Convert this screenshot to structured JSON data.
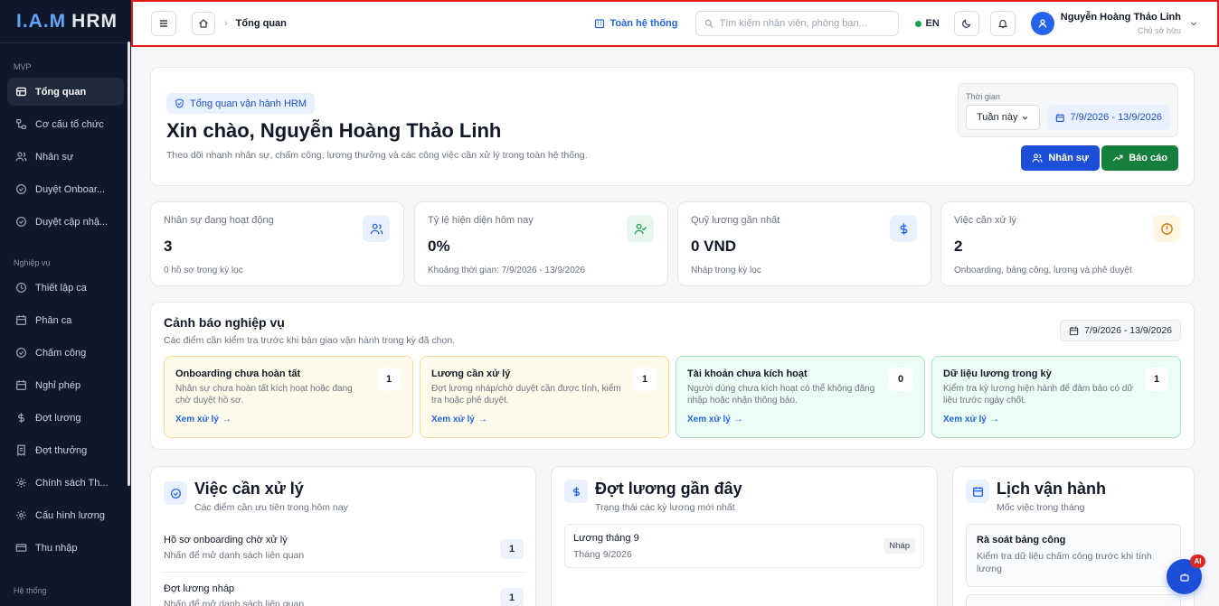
{
  "app": {
    "logo_iam": "I.A.M",
    "logo_hrm": "HRM"
  },
  "sidebar": {
    "sections": [
      "MVP",
      "Nghiệp vụ",
      "Hệ thống"
    ],
    "items": [
      {
        "label": "Tổng quan",
        "icon": "dashboard-icon"
      },
      {
        "label": "Cơ cấu tổ chức",
        "icon": "org-chart-icon"
      },
      {
        "label": "Nhân sự",
        "icon": "users-icon"
      },
      {
        "label": "Duyệt Onboar...",
        "icon": "check-circle-icon"
      },
      {
        "label": "Duyệt cập nhậ...",
        "icon": "check-circle-icon"
      },
      {
        "label": "Thiết lập ca",
        "icon": "clock-icon"
      },
      {
        "label": "Phân ca",
        "icon": "calendar-icon"
      },
      {
        "label": "Chấm công",
        "icon": "check-circle-icon"
      },
      {
        "label": "Nghỉ phép",
        "icon": "calendar-icon"
      },
      {
        "label": "Đợt lương",
        "icon": "dollar-icon"
      },
      {
        "label": "Đợt thưởng",
        "icon": "receipt-icon"
      },
      {
        "label": "Chính sách Th...",
        "icon": "gear-icon"
      },
      {
        "label": "Cấu hình lương",
        "icon": "gear-icon"
      },
      {
        "label": "Thu nhập",
        "icon": "wallet-icon"
      }
    ]
  },
  "header": {
    "breadcrumb": "Tổng quan",
    "scope": "Toàn hệ thống",
    "search_placeholder": "Tìm kiếm nhân viên, phòng ban...",
    "lang": "EN",
    "user_name": "Nguyễn Hoàng Thảo Linh",
    "user_role": "Chủ sở hữu"
  },
  "hero": {
    "badge": "Tổng quan vận hành HRM",
    "title": "Xin chào, Nguyễn Hoàng Thảo Linh",
    "subtitle": "Theo dõi nhanh nhân sự, chấm công, lương thưởng và các công việc cần xử lý trong toàn hệ thống.",
    "time_label": "Thời gian",
    "period": "Tuần này",
    "range": "7/9/2026 - 13/9/2026",
    "btn_staff": "Nhân sự",
    "btn_report": "Báo cáo"
  },
  "stats": [
    {
      "label": "Nhân sự đang hoạt động",
      "value": "3",
      "sub": "0 hồ sơ trong kỳ lọc",
      "icon": "users-icon",
      "color": "#2563eb",
      "bg": "#eaf1fe"
    },
    {
      "label": "Tỷ lệ hiện diện hôm nay",
      "value": "0%",
      "sub": "Khoảng thời gian: 7/9/2026 - 13/9/2026",
      "icon": "user-check-icon",
      "color": "#16a34a",
      "bg": "#e8f7ee"
    },
    {
      "label": "Quỹ lương gần nhất",
      "value": "0 VND",
      "sub": "Nháp trong kỳ lọc",
      "icon": "dollar-icon",
      "color": "#2563eb",
      "bg": "#eaf1fe"
    },
    {
      "label": "Việc cần xử lý",
      "value": "2",
      "sub": "Onboarding, bảng công, lương và phê duyệt",
      "icon": "alert-circle-icon",
      "color": "#d97706",
      "bg": "#fef6e4"
    }
  ],
  "alerts": {
    "title": "Cảnh báo nghiệp vụ",
    "subtitle": "Các điểm cần kiểm tra trước khi bàn giao vận hành trong kỳ đã chọn.",
    "range": "7/9/2026 - 13/9/2026",
    "link": "Xem xử lý",
    "items": [
      {
        "title": "Onboarding chưa hoàn tất",
        "desc": "Nhân sự chưa hoàn tất kích hoạt hoặc đang chờ duyệt hồ sơ.",
        "count": "1",
        "bg": "#fffbeb",
        "border": "#f6dd97"
      },
      {
        "title": "Lương cần xử lý",
        "desc": "Đợt lương nháp/chờ duyệt cần được tính, kiểm tra hoặc phê duyệt.",
        "count": "1",
        "bg": "#fffbeb",
        "border": "#f6dd97"
      },
      {
        "title": "Tài khoản chưa kích hoạt",
        "desc": "Người dùng chưa kích hoạt có thể không đăng nhập hoặc nhận thông báo.",
        "count": "0",
        "bg": "#ecfdf5",
        "border": "#a7e3c4"
      },
      {
        "title": "Dữ liệu lương trong kỳ",
        "desc": "Kiểm tra kỳ lương hiện hành để đảm bảo có dữ liệu trước ngày chốt.",
        "count": "1",
        "bg": "#ecfdf5",
        "border": "#a7e3c4"
      }
    ]
  },
  "tasks": {
    "title": "Việc cần xử lý",
    "subtitle": "Các điểm cần ưu tiên trong hôm nay",
    "items": [
      {
        "title": "Hồ sơ onboarding chờ xử lý",
        "desc": "Nhấn để mở danh sách liên quan",
        "count": "1"
      },
      {
        "title": "Đợt lương nháp",
        "desc": "Nhấn để mở danh sách liên quan",
        "count": "1"
      }
    ]
  },
  "payroll": {
    "title": "Đợt lương gần đây",
    "subtitle": "Trạng thái các kỳ lương mới nhất",
    "items": [
      {
        "name": "Lương tháng 9",
        "period": "Tháng 9/2026",
        "status": "Nháp"
      }
    ]
  },
  "schedule": {
    "title": "Lịch vận hành",
    "subtitle": "Mốc việc trong tháng",
    "items": [
      {
        "title": "Rà soát bảng công",
        "desc": "Kiểm tra dữ liệu chấm công trước khi tính lương"
      }
    ]
  },
  "ai_badge": "AI"
}
